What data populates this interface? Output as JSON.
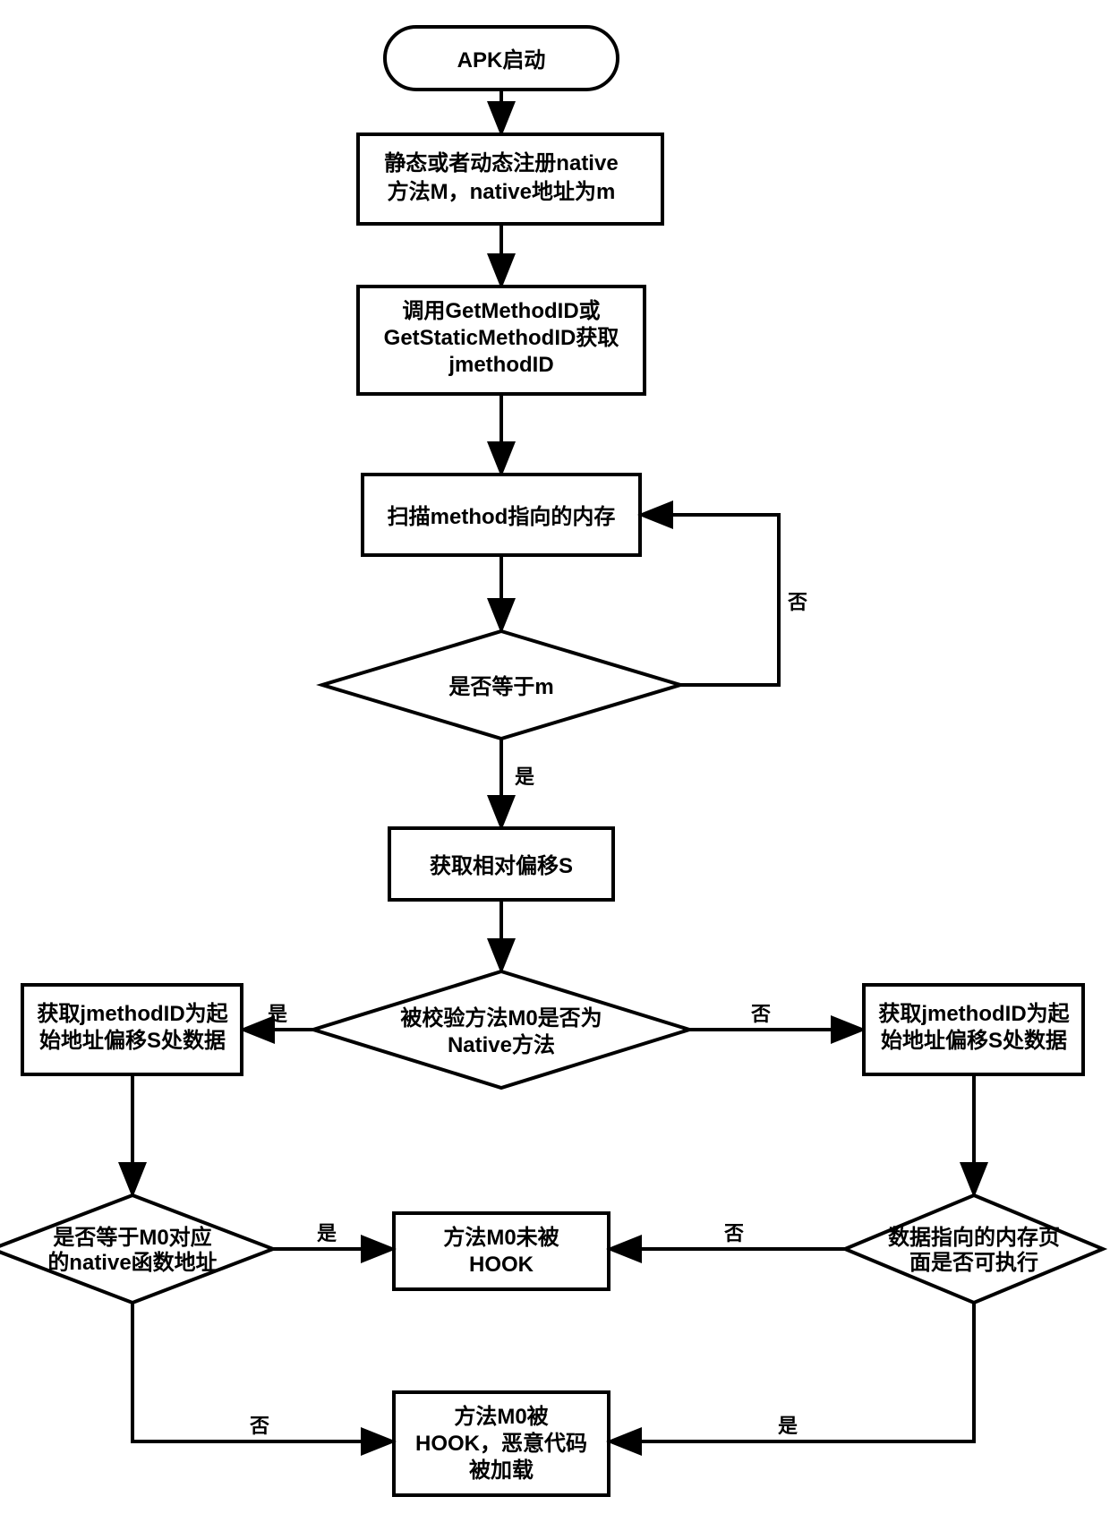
{
  "flowchart": {
    "nodes": {
      "start": {
        "text": "APK启动"
      },
      "register": {
        "line1": "静态或者动态注册native",
        "line2": "方法M，native地址为m"
      },
      "getmethod": {
        "line1": "调用GetMethodID或",
        "line2": "GetStaticMethodID获取",
        "line3": "jmethodID"
      },
      "scan": {
        "text": "扫描method指向的内存"
      },
      "equal_m": {
        "text": "是否等于m"
      },
      "offset_s": {
        "text": "获取相对偏移S"
      },
      "is_native": {
        "line1": "被校验方法M0是否为",
        "line2": "Native方法"
      },
      "left_get": {
        "line1": "获取jmethodID为起",
        "line2": "始地址偏移S处数据"
      },
      "right_get": {
        "line1": "获取jmethodID为起",
        "line2": "始地址偏移S处数据"
      },
      "left_check": {
        "line1": "是否等于M0对应",
        "line2": "的native函数地址"
      },
      "right_check": {
        "line1": "数据指向的内存页",
        "line2": "面是否可执行"
      },
      "not_hooked": {
        "line1": "方法M0未被",
        "line2": "HOOK"
      },
      "hooked": {
        "line1": "方法M0被",
        "line2": "HOOK，恶意代码",
        "line3": "被加载"
      }
    },
    "edge_labels": {
      "yes": "是",
      "no": "否"
    }
  }
}
